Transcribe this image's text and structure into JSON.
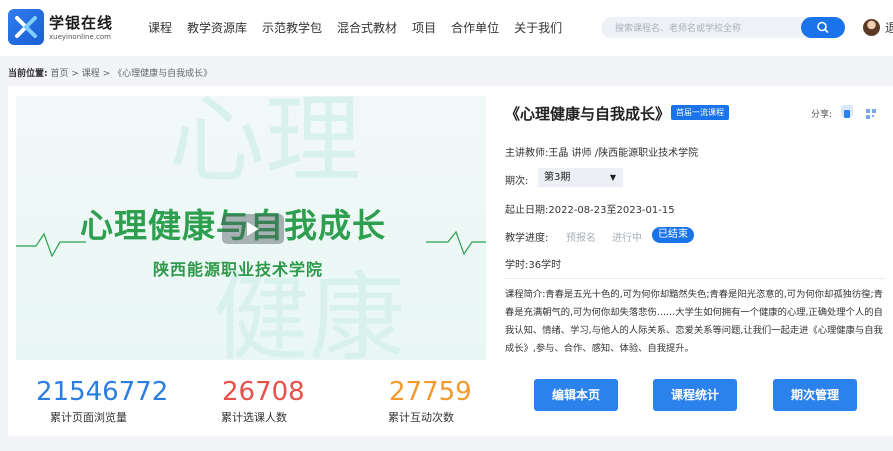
{
  "header": {
    "logo_name": "学银在线",
    "logo_url": "xueyinonline.com",
    "nav": [
      "课程",
      "教学资源库",
      "示范教学包",
      "混合式教材",
      "项目",
      "合作单位",
      "关于我们"
    ],
    "search_placeholder": "搜索课程名、老师名或学校全称",
    "logout": "退出"
  },
  "breadcrumb": {
    "label": "当前位置:",
    "home": "首页",
    "sep": ">",
    "courses": "课程",
    "current": "《心理健康与自我成长》"
  },
  "video": {
    "bg_char_1": "心理",
    "bg_char_2": "健康",
    "title": "心理健康与自我成长",
    "subtitle": "陕西能源职业技术学院"
  },
  "stats": [
    {
      "value": "21546772",
      "label": "累计页面浏览量",
      "color": "#2b7de0"
    },
    {
      "value": "26708",
      "label": "累计选课人数",
      "color": "#e8504a"
    },
    {
      "value": "27759",
      "label": "累计互动次数",
      "color": "#f29a2e"
    }
  ],
  "course": {
    "title": "《心理健康与自我成长》",
    "tag": "首届一流课程",
    "share_label": "分享:",
    "teacher": "主讲教师:王晶 讲师 /陕西能源职业技术学院",
    "term_label": "期次:",
    "term_value": "第3期",
    "dates": "起止日期:2022-08-23至2023-01-15",
    "progress_label": "教学进度:",
    "progress_steps": [
      "预报名",
      "进行中",
      "已结束"
    ],
    "hours": "学时:36学时",
    "intro": "课程简介:青春是五光十色的,可为何你却黯然失色;青春是阳光恣意的,可为何你却孤独彷徨;青春是充满朝气的,可为何你却失落悲伤……大学生如何拥有一个健康的心理,正确处理个人的自我认知、情绪、学习,与他人的人际关系、恋爱关系等问题,让我们一起走进《心理健康与自我成长》,参与、合作、感知、体验、自我提升。"
  },
  "buttons": {
    "edit": "编辑本页",
    "stats": "课程统计",
    "terms": "期次管理"
  },
  "colors": {
    "accent": "#1a73e8",
    "button": "#2b82ec"
  }
}
